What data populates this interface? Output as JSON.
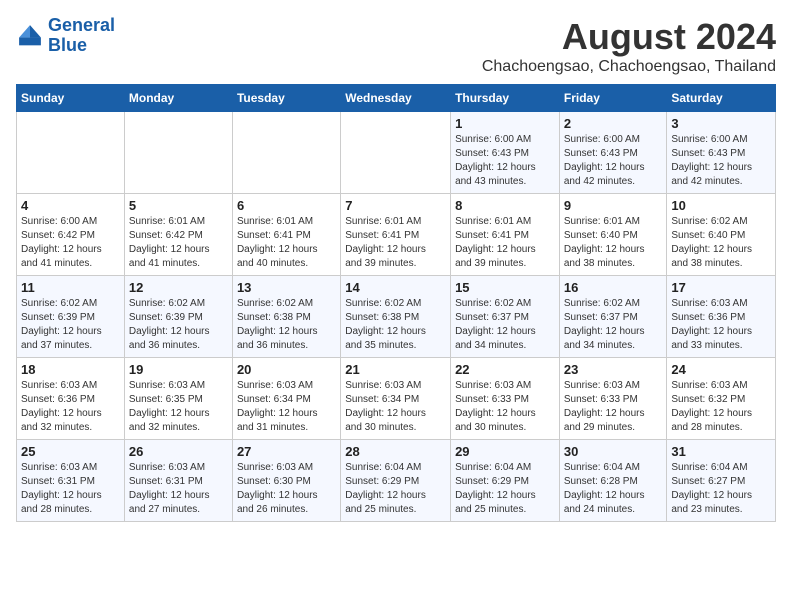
{
  "logo": {
    "line1": "General",
    "line2": "Blue"
  },
  "title": "August 2024",
  "subtitle": "Chachoengsao, Chachoengsao, Thailand",
  "days_header": [
    "Sunday",
    "Monday",
    "Tuesday",
    "Wednesday",
    "Thursday",
    "Friday",
    "Saturday"
  ],
  "weeks": [
    [
      {
        "num": "",
        "info": ""
      },
      {
        "num": "",
        "info": ""
      },
      {
        "num": "",
        "info": ""
      },
      {
        "num": "",
        "info": ""
      },
      {
        "num": "1",
        "info": "Sunrise: 6:00 AM\nSunset: 6:43 PM\nDaylight: 12 hours\nand 43 minutes."
      },
      {
        "num": "2",
        "info": "Sunrise: 6:00 AM\nSunset: 6:43 PM\nDaylight: 12 hours\nand 42 minutes."
      },
      {
        "num": "3",
        "info": "Sunrise: 6:00 AM\nSunset: 6:43 PM\nDaylight: 12 hours\nand 42 minutes."
      }
    ],
    [
      {
        "num": "4",
        "info": "Sunrise: 6:00 AM\nSunset: 6:42 PM\nDaylight: 12 hours\nand 41 minutes."
      },
      {
        "num": "5",
        "info": "Sunrise: 6:01 AM\nSunset: 6:42 PM\nDaylight: 12 hours\nand 41 minutes."
      },
      {
        "num": "6",
        "info": "Sunrise: 6:01 AM\nSunset: 6:41 PM\nDaylight: 12 hours\nand 40 minutes."
      },
      {
        "num": "7",
        "info": "Sunrise: 6:01 AM\nSunset: 6:41 PM\nDaylight: 12 hours\nand 39 minutes."
      },
      {
        "num": "8",
        "info": "Sunrise: 6:01 AM\nSunset: 6:41 PM\nDaylight: 12 hours\nand 39 minutes."
      },
      {
        "num": "9",
        "info": "Sunrise: 6:01 AM\nSunset: 6:40 PM\nDaylight: 12 hours\nand 38 minutes."
      },
      {
        "num": "10",
        "info": "Sunrise: 6:02 AM\nSunset: 6:40 PM\nDaylight: 12 hours\nand 38 minutes."
      }
    ],
    [
      {
        "num": "11",
        "info": "Sunrise: 6:02 AM\nSunset: 6:39 PM\nDaylight: 12 hours\nand 37 minutes."
      },
      {
        "num": "12",
        "info": "Sunrise: 6:02 AM\nSunset: 6:39 PM\nDaylight: 12 hours\nand 36 minutes."
      },
      {
        "num": "13",
        "info": "Sunrise: 6:02 AM\nSunset: 6:38 PM\nDaylight: 12 hours\nand 36 minutes."
      },
      {
        "num": "14",
        "info": "Sunrise: 6:02 AM\nSunset: 6:38 PM\nDaylight: 12 hours\nand 35 minutes."
      },
      {
        "num": "15",
        "info": "Sunrise: 6:02 AM\nSunset: 6:37 PM\nDaylight: 12 hours\nand 34 minutes."
      },
      {
        "num": "16",
        "info": "Sunrise: 6:02 AM\nSunset: 6:37 PM\nDaylight: 12 hours\nand 34 minutes."
      },
      {
        "num": "17",
        "info": "Sunrise: 6:03 AM\nSunset: 6:36 PM\nDaylight: 12 hours\nand 33 minutes."
      }
    ],
    [
      {
        "num": "18",
        "info": "Sunrise: 6:03 AM\nSunset: 6:36 PM\nDaylight: 12 hours\nand 32 minutes."
      },
      {
        "num": "19",
        "info": "Sunrise: 6:03 AM\nSunset: 6:35 PM\nDaylight: 12 hours\nand 32 minutes."
      },
      {
        "num": "20",
        "info": "Sunrise: 6:03 AM\nSunset: 6:34 PM\nDaylight: 12 hours\nand 31 minutes."
      },
      {
        "num": "21",
        "info": "Sunrise: 6:03 AM\nSunset: 6:34 PM\nDaylight: 12 hours\nand 30 minutes."
      },
      {
        "num": "22",
        "info": "Sunrise: 6:03 AM\nSunset: 6:33 PM\nDaylight: 12 hours\nand 30 minutes."
      },
      {
        "num": "23",
        "info": "Sunrise: 6:03 AM\nSunset: 6:33 PM\nDaylight: 12 hours\nand 29 minutes."
      },
      {
        "num": "24",
        "info": "Sunrise: 6:03 AM\nSunset: 6:32 PM\nDaylight: 12 hours\nand 28 minutes."
      }
    ],
    [
      {
        "num": "25",
        "info": "Sunrise: 6:03 AM\nSunset: 6:31 PM\nDaylight: 12 hours\nand 28 minutes."
      },
      {
        "num": "26",
        "info": "Sunrise: 6:03 AM\nSunset: 6:31 PM\nDaylight: 12 hours\nand 27 minutes."
      },
      {
        "num": "27",
        "info": "Sunrise: 6:03 AM\nSunset: 6:30 PM\nDaylight: 12 hours\nand 26 minutes."
      },
      {
        "num": "28",
        "info": "Sunrise: 6:04 AM\nSunset: 6:29 PM\nDaylight: 12 hours\nand 25 minutes."
      },
      {
        "num": "29",
        "info": "Sunrise: 6:04 AM\nSunset: 6:29 PM\nDaylight: 12 hours\nand 25 minutes."
      },
      {
        "num": "30",
        "info": "Sunrise: 6:04 AM\nSunset: 6:28 PM\nDaylight: 12 hours\nand 24 minutes."
      },
      {
        "num": "31",
        "info": "Sunrise: 6:04 AM\nSunset: 6:27 PM\nDaylight: 12 hours\nand 23 minutes."
      }
    ]
  ]
}
